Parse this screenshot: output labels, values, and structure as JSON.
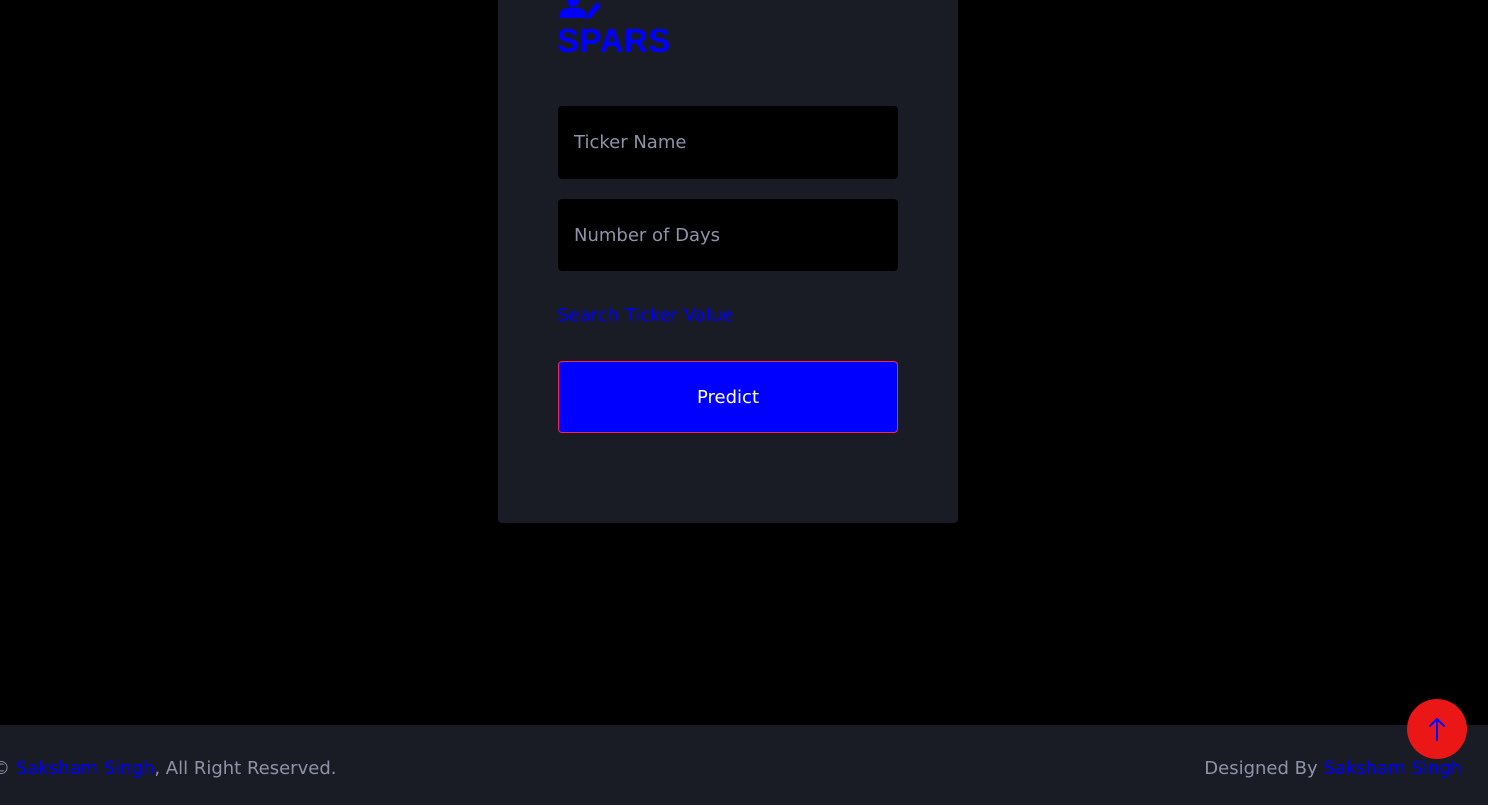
{
  "brand": {
    "name": "SPARS",
    "icon": "user-edit-icon"
  },
  "form": {
    "ticker_placeholder": "Ticker Name",
    "ticker_value": "",
    "days_placeholder": "Number of Days",
    "days_value": "",
    "search_link": "Search Ticker Value",
    "predict_label": "Predict"
  },
  "footer": {
    "copyright_symbol": "©",
    "copyright_name": "Saksham Singh",
    "copyright_suffix": ", All Right Reserved.",
    "designed_prefix": "Designed By",
    "designed_name": "Saksham Singh"
  },
  "back_to_top": {
    "icon": "arrow-up-icon"
  },
  "colors": {
    "background": "#000000",
    "panel": "#191c24",
    "accent_blue": "#0000ff",
    "accent_red": "#eb1616",
    "muted_text": "#8f93a8"
  }
}
